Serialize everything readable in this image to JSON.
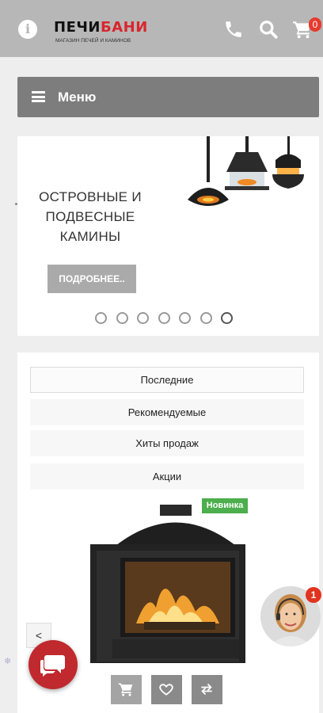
{
  "header": {
    "info_icon": "info-icon",
    "logo_main_black": "ПЕЧИ",
    "logo_main_red": "БАНИ",
    "logo_sub": "МАГАЗИН ПЕЧЕЙ И КАМИНОВ",
    "phone_icon": "phone-icon",
    "search_icon": "search-icon",
    "cart_icon": "cart-icon",
    "cart_count": "0"
  },
  "menu": {
    "label": "Меню"
  },
  "slider": {
    "title_lines": [
      "ОСТРОВНЫЕ И",
      "ПОДВЕСНЫЕ",
      "КАМИНЫ"
    ],
    "button_label": "ПОДРОБНЕЕ..",
    "dot_count": 7,
    "active_dot": 7
  },
  "products": {
    "tabs": [
      {
        "label": "Последние"
      },
      {
        "label": "Рекомендуемые"
      },
      {
        "label": "Хиты продаж"
      },
      {
        "label": "Акции"
      }
    ],
    "active_tab": 0,
    "item": {
      "badge": "Новинка"
    },
    "prev_label": "<"
  },
  "widgets": {
    "chat_icon": "chat-icon",
    "consultant_badge": "1"
  },
  "colors": {
    "header_bg": "#b7b7b7",
    "brand_red": "#d9262d",
    "menu_bg": "#7d7d7d",
    "badge_green": "#4cae4c",
    "chat_red": "#c0292e"
  }
}
